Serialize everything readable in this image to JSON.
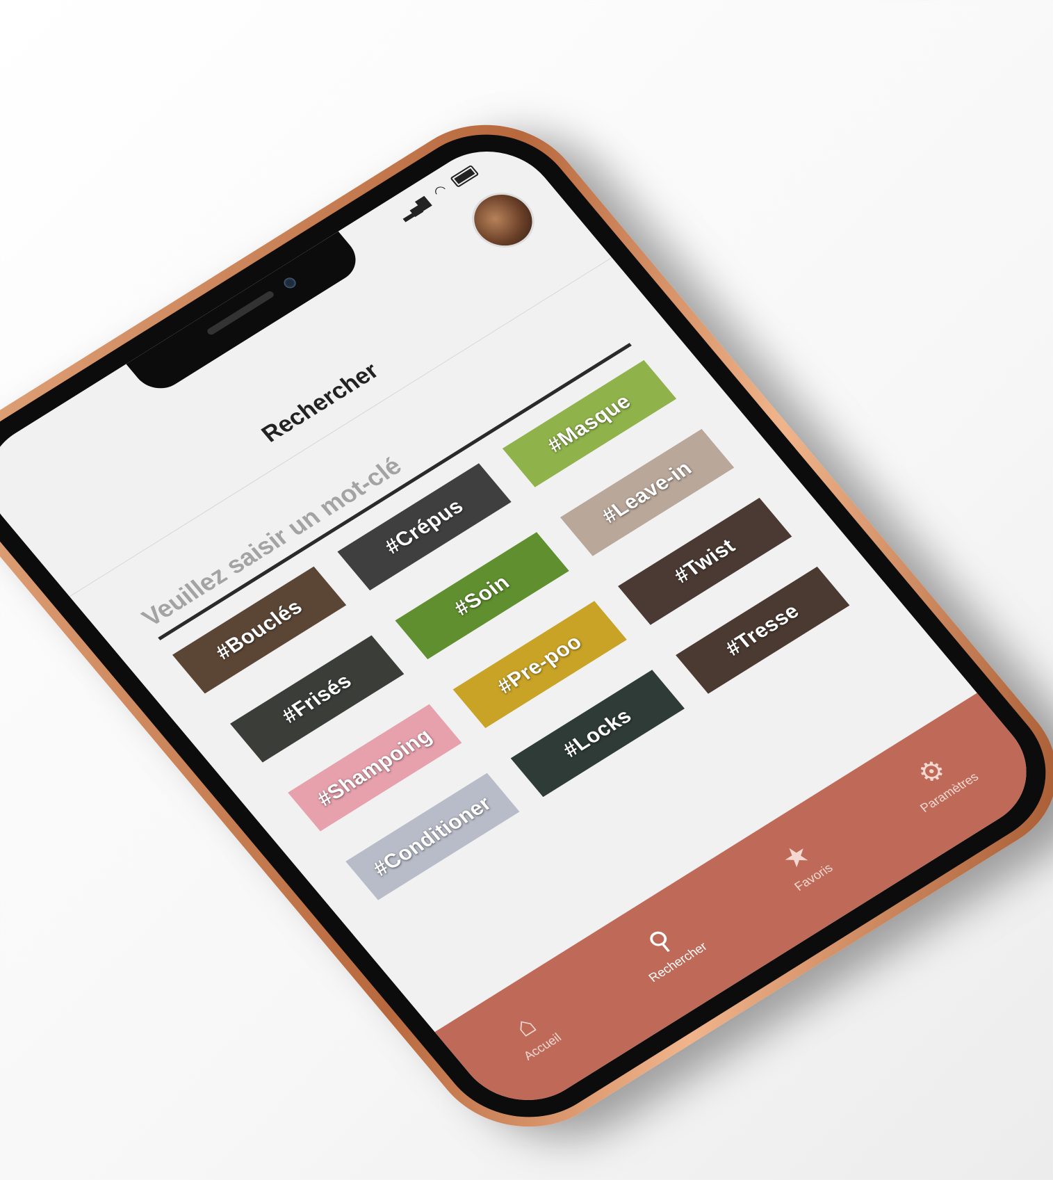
{
  "page": {
    "title": "Rechercher"
  },
  "search": {
    "placeholder": "Veuillez saisir un mot-clé"
  },
  "tags": [
    {
      "label": "#Bouclés",
      "color": "#5b4636"
    },
    {
      "label": "#Crépus",
      "color": "#3f3f3f"
    },
    {
      "label": "#Masque",
      "color": "#8fb34a"
    },
    {
      "label": "#Frisés",
      "color": "#3a3d38"
    },
    {
      "label": "#Soin",
      "color": "#5f8f2e"
    },
    {
      "label": "#Leave-in",
      "color": "#b9a79a"
    },
    {
      "label": "#Shampoing",
      "color": "#e6a1ad"
    },
    {
      "label": "#Pre-poo",
      "color": "#c9a326"
    },
    {
      "label": "#Twist",
      "color": "#4a3a33"
    },
    {
      "label": "#Conditioner",
      "color": "#b7bcc8"
    },
    {
      "label": "#Locks",
      "color": "#2e3b36"
    },
    {
      "label": "#Tresse",
      "color": "#4b3a31"
    }
  ],
  "tabbar": {
    "accent": "#bf6a58",
    "items": [
      {
        "label": "Accueil",
        "icon": "home-icon",
        "glyph": "⌂"
      },
      {
        "label": "Rechercher",
        "icon": "search-icon",
        "glyph": "⚲"
      },
      {
        "label": "Favoris",
        "icon": "star-icon",
        "glyph": "★"
      },
      {
        "label": "Paramètres",
        "icon": "gear-icon",
        "glyph": "⚙"
      }
    ]
  }
}
